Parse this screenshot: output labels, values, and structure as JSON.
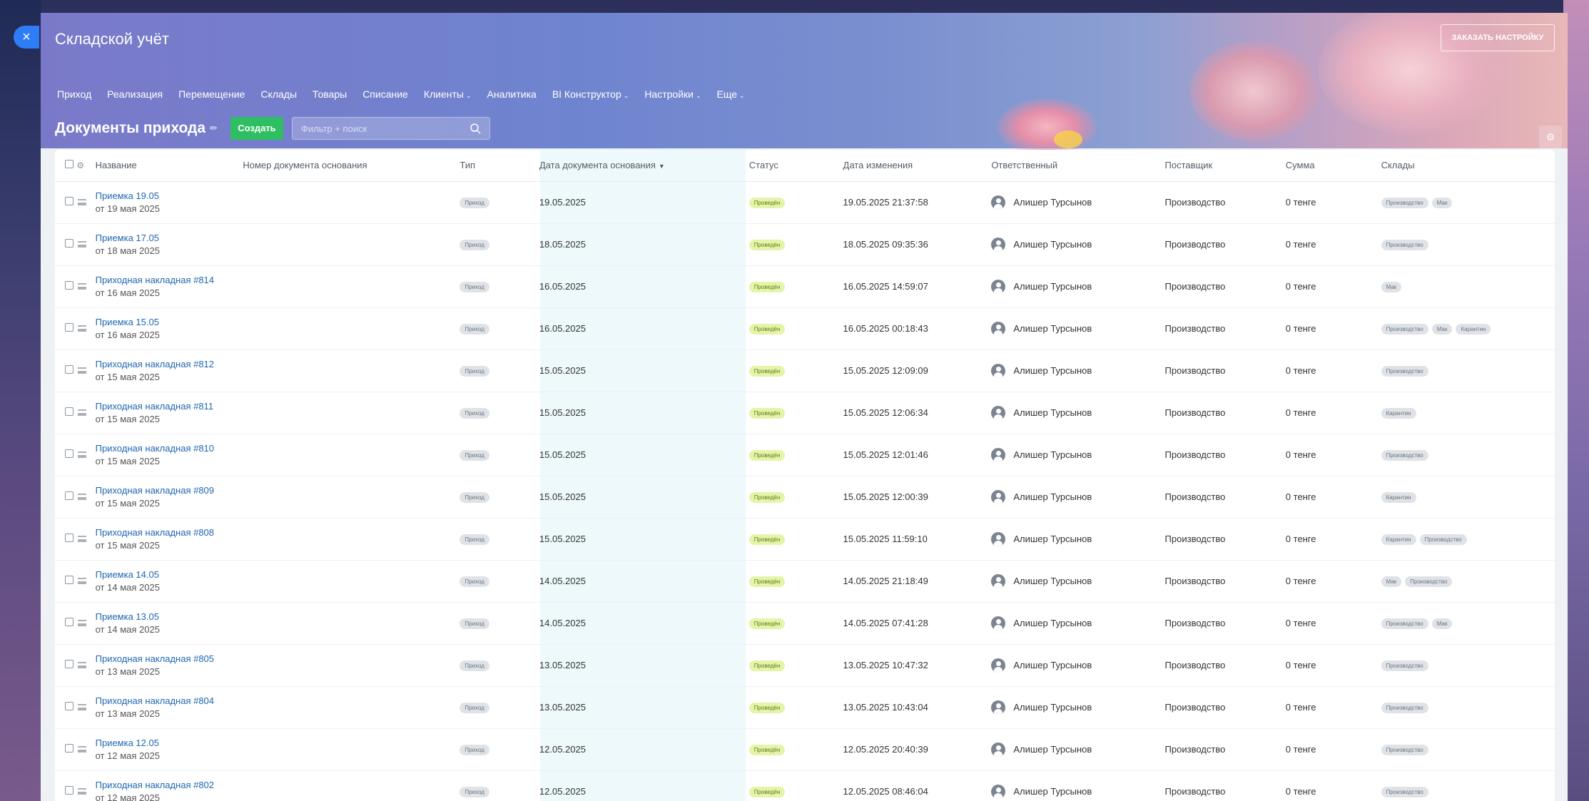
{
  "app": {
    "title": "Складской учёт",
    "order_button": "ЗАКАЗАТЬ НАСТРОЙКУ",
    "close_label": "×"
  },
  "nav": {
    "items": [
      {
        "label": "Приход",
        "dropdown": false
      },
      {
        "label": "Реализация",
        "dropdown": false
      },
      {
        "label": "Перемещение",
        "dropdown": false
      },
      {
        "label": "Склады",
        "dropdown": false
      },
      {
        "label": "Товары",
        "dropdown": false
      },
      {
        "label": "Списание",
        "dropdown": false
      },
      {
        "label": "Клиенты",
        "dropdown": true
      },
      {
        "label": "Аналитика",
        "dropdown": false
      },
      {
        "label": "BI Конструктор",
        "dropdown": true
      },
      {
        "label": "Настройки",
        "dropdown": true
      },
      {
        "label": "Еще",
        "dropdown": true
      }
    ]
  },
  "toolbar": {
    "page_title": "Документы прихода",
    "create_label": "Создать",
    "search_placeholder": "Фильтр + поиск"
  },
  "table": {
    "columns": {
      "name": "Название",
      "base_number": "Номер документа основания",
      "type": "Тип",
      "base_date": "Дата документа основания",
      "status": "Статус",
      "modified": "Дата изменения",
      "responsible": "Ответственный",
      "supplier": "Поставщик",
      "sum": "Сумма",
      "warehouses": "Склады"
    },
    "rows": [
      {
        "name": "Приемка 19.05",
        "sub": "от 19 мая 2025",
        "type": "Приход",
        "base_date": "19.05.2025",
        "status": "Проведён",
        "modified": "19.05.2025 21:37:58",
        "responsible": "Алишер Турсынов",
        "supplier": "Производство",
        "sum": "0 тенге",
        "warehouses": [
          "Производство",
          "Мак"
        ]
      },
      {
        "name": "Приемка 17.05",
        "sub": "от 18 мая 2025",
        "type": "Приход",
        "base_date": "18.05.2025",
        "status": "Проведён",
        "modified": "18.05.2025 09:35:36",
        "responsible": "Алишер Турсынов",
        "supplier": "Производство",
        "sum": "0 тенге",
        "warehouses": [
          "Производство"
        ]
      },
      {
        "name": "Приходная накладная #814",
        "sub": "от 16 мая 2025",
        "type": "Приход",
        "base_date": "16.05.2025",
        "status": "Проведён",
        "modified": "16.05.2025 14:59:07",
        "responsible": "Алишер Турсынов",
        "supplier": "Производство",
        "sum": "0 тенге",
        "warehouses": [
          "Мак"
        ]
      },
      {
        "name": "Приемка 15.05",
        "sub": "от 16 мая 2025",
        "type": "Приход",
        "base_date": "16.05.2025",
        "status": "Проведён",
        "modified": "16.05.2025 00:18:43",
        "responsible": "Алишер Турсынов",
        "supplier": "Производство",
        "sum": "0 тенге",
        "warehouses": [
          "Производство",
          "Мак",
          "Карантин"
        ]
      },
      {
        "name": "Приходная накладная #812",
        "sub": "от 15 мая 2025",
        "type": "Приход",
        "base_date": "15.05.2025",
        "status": "Проведён",
        "modified": "15.05.2025 12:09:09",
        "responsible": "Алишер Турсынов",
        "supplier": "Производство",
        "sum": "0 тенге",
        "warehouses": [
          "Производство"
        ]
      },
      {
        "name": "Приходная накладная #811",
        "sub": "от 15 мая 2025",
        "type": "Приход",
        "base_date": "15.05.2025",
        "status": "Проведён",
        "modified": "15.05.2025 12:06:34",
        "responsible": "Алишер Турсынов",
        "supplier": "Производство",
        "sum": "0 тенге",
        "warehouses": [
          "Карантин"
        ]
      },
      {
        "name": "Приходная накладная #810",
        "sub": "от 15 мая 2025",
        "type": "Приход",
        "base_date": "15.05.2025",
        "status": "Проведён",
        "modified": "15.05.2025 12:01:46",
        "responsible": "Алишер Турсынов",
        "supplier": "Производство",
        "sum": "0 тенге",
        "warehouses": [
          "Производство"
        ]
      },
      {
        "name": "Приходная накладная #809",
        "sub": "от 15 мая 2025",
        "type": "Приход",
        "base_date": "15.05.2025",
        "status": "Проведён",
        "modified": "15.05.2025 12:00:39",
        "responsible": "Алишер Турсынов",
        "supplier": "Производство",
        "sum": "0 тенге",
        "warehouses": [
          "Карантин"
        ]
      },
      {
        "name": "Приходная накладная #808",
        "sub": "от 15 мая 2025",
        "type": "Приход",
        "base_date": "15.05.2025",
        "status": "Проведён",
        "modified": "15.05.2025 11:59:10",
        "responsible": "Алишер Турсынов",
        "supplier": "Производство",
        "sum": "0 тенге",
        "warehouses": [
          "Карантин",
          "Производство"
        ]
      },
      {
        "name": "Приемка 14.05",
        "sub": "от 14 мая 2025",
        "type": "Приход",
        "base_date": "14.05.2025",
        "status": "Проведён",
        "modified": "14.05.2025 21:18:49",
        "responsible": "Алишер Турсынов",
        "supplier": "Производство",
        "sum": "0 тенге",
        "warehouses": [
          "Мак",
          "Производство"
        ]
      },
      {
        "name": "Приемка 13.05",
        "sub": "от 14 мая 2025",
        "type": "Приход",
        "base_date": "14.05.2025",
        "status": "Проведён",
        "modified": "14.05.2025 07:41:28",
        "responsible": "Алишер Турсынов",
        "supplier": "Производство",
        "sum": "0 тенге",
        "warehouses": [
          "Производство",
          "Мак"
        ]
      },
      {
        "name": "Приходная накладная #805",
        "sub": "от 13 мая 2025",
        "type": "Приход",
        "base_date": "13.05.2025",
        "status": "Проведён",
        "modified": "13.05.2025 10:47:32",
        "responsible": "Алишер Турсынов",
        "supplier": "Производство",
        "sum": "0 тенге",
        "warehouses": [
          "Производство"
        ]
      },
      {
        "name": "Приходная накладная #804",
        "sub": "от 13 мая 2025",
        "type": "Приход",
        "base_date": "13.05.2025",
        "status": "Проведён",
        "modified": "13.05.2025 10:43:04",
        "responsible": "Алишер Турсынов",
        "supplier": "Производство",
        "sum": "0 тенге",
        "warehouses": [
          "Производство"
        ]
      },
      {
        "name": "Приемка 12.05",
        "sub": "от 12 мая 2025",
        "type": "Приход",
        "base_date": "12.05.2025",
        "status": "Проведён",
        "modified": "12.05.2025 20:40:39",
        "responsible": "Алишер Турсынов",
        "supplier": "Производство",
        "sum": "0 тенге",
        "warehouses": [
          "Производство"
        ]
      },
      {
        "name": "Приходная накладная #802",
        "sub": "от 12 мая 2025",
        "type": "Приход",
        "base_date": "12.05.2025",
        "status": "Проведён",
        "modified": "12.05.2025 08:46:04",
        "responsible": "Алишер Турсынов",
        "supplier": "Производство",
        "sum": "0 тенге",
        "warehouses": [
          "Производство"
        ]
      }
    ]
  },
  "colors": {
    "accent": "#2e7cf6",
    "create_button": "#2fbf63",
    "link": "#2067b0",
    "status_pill": "#e4f4a8"
  },
  "icons": {
    "close": "close-icon",
    "pin": "pin-icon",
    "search": "search-icon",
    "settings": "gear-icon",
    "drag": "drag-handle-icon",
    "avatar": "user-avatar-icon"
  }
}
